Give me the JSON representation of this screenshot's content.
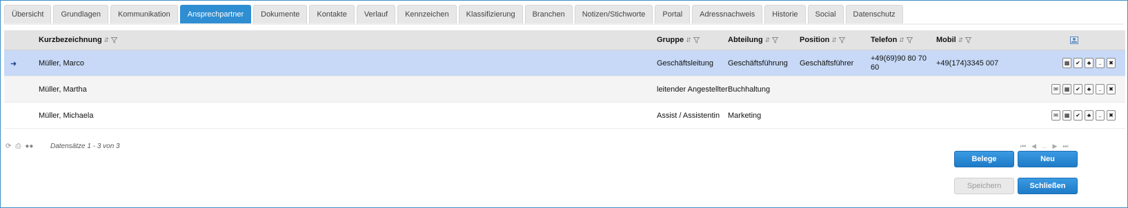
{
  "tabs": [
    {
      "label": "Übersicht"
    },
    {
      "label": "Grundlagen"
    },
    {
      "label": "Kommunikation"
    },
    {
      "label": "Ansprechpartner",
      "active": true
    },
    {
      "label": "Dokumente"
    },
    {
      "label": "Kontakte"
    },
    {
      "label": "Verlauf"
    },
    {
      "label": "Kennzeichen"
    },
    {
      "label": "Klassifizierung"
    },
    {
      "label": "Branchen"
    },
    {
      "label": "Notizen/Stichworte"
    },
    {
      "label": "Portal"
    },
    {
      "label": "Adressnachweis"
    },
    {
      "label": "Historie"
    },
    {
      "label": "Social"
    },
    {
      "label": "Datenschutz"
    }
  ],
  "grid": {
    "columns": {
      "kurz": "Kurzbezeichnung",
      "gruppe": "Gruppe",
      "abteilung": "Abteilung",
      "position": "Position",
      "telefon": "Telefon",
      "mobil": "Mobil"
    },
    "rows": [
      {
        "kurz": "Müller, Marco",
        "gruppe": "Geschäftsleitung",
        "abteilung": "Geschäftsführung",
        "position": "Geschäftsführer",
        "telefon": "+49(69)90 80 70 60",
        "mobil": "+49(174)3345 007",
        "selected": true
      },
      {
        "kurz": "Müller, Martha",
        "gruppe": "leitender Angestellter",
        "abteilung": "Buchhaltung",
        "position": "",
        "telefon": "",
        "mobil": ""
      },
      {
        "kurz": "Müller, Michaela",
        "gruppe": "Assist / Assistentin",
        "abteilung": "Marketing",
        "position": "",
        "telefon": "",
        "mobil": ""
      }
    ],
    "record_info": "Datensätze 1 - 3 von 3",
    "pager_ellipsis": "..."
  },
  "buttons": {
    "belege": "Belege",
    "neu": "Neu",
    "speichern": "Speichern",
    "schliessen": "Schließen"
  },
  "icons": {
    "selected_row": "arrow-right-icon",
    "sort": "sort-icon",
    "filter": "filter-icon",
    "refresh": "refresh-icon",
    "print": "print-icon",
    "users": "users-icon"
  },
  "colors": {
    "accent": "#2f8ed2",
    "selected_row": "#c7d9f6",
    "header_bg": "#e3e3e3"
  }
}
